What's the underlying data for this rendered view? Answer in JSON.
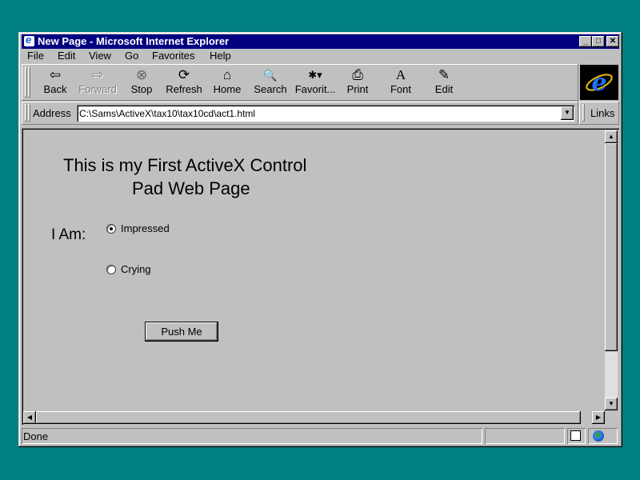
{
  "window": {
    "title": "New Page - Microsoft Internet Explorer",
    "controls": {
      "minimize": "_",
      "maximize": "□",
      "close": "✕"
    }
  },
  "menu": [
    "File",
    "Edit",
    "View",
    "Go",
    "Favorites",
    "Help"
  ],
  "toolbar": {
    "buttons": [
      {
        "label": "Back",
        "icon": "back-arrow-icon",
        "glyph": "⇦",
        "enabled": true
      },
      {
        "label": "Forward",
        "icon": "forward-arrow-icon",
        "glyph": "⇨",
        "enabled": false
      },
      {
        "label": "Stop",
        "icon": "stop-icon",
        "glyph": "⊗",
        "enabled": true
      },
      {
        "label": "Refresh",
        "icon": "refresh-icon",
        "glyph": "⟳",
        "enabled": true
      },
      {
        "label": "Home",
        "icon": "home-icon",
        "glyph": "⌂",
        "enabled": true
      },
      {
        "label": "Search",
        "icon": "search-icon",
        "glyph": "🔍",
        "enabled": true
      },
      {
        "label": "Favorit...",
        "icon": "favorites-icon",
        "glyph": "✱▾",
        "enabled": true
      },
      {
        "label": "Print",
        "icon": "printer-icon",
        "glyph": "⎙",
        "enabled": true
      },
      {
        "label": "Font",
        "icon": "font-icon",
        "glyph": "A",
        "enabled": true
      },
      {
        "label": "Edit",
        "icon": "edit-icon",
        "glyph": "✎",
        "enabled": true
      }
    ]
  },
  "address": {
    "label": "Address",
    "value": "C:\\Sams\\ActiveX\\tax10\\tax10cd\\act1.html",
    "links_label": "Links"
  },
  "page": {
    "heading_line1": "This is my First ActiveX Control",
    "heading_line2": "Pad Web Page",
    "question_label": "I Am:",
    "options": [
      {
        "label": "Impressed",
        "checked": true
      },
      {
        "label": "Crying",
        "checked": false
      }
    ],
    "button_label": "Push Me"
  },
  "status": {
    "text": "Done"
  },
  "colors": {
    "desktop": "#008080",
    "titlebar": "#000080",
    "face": "#c0c0c0"
  }
}
